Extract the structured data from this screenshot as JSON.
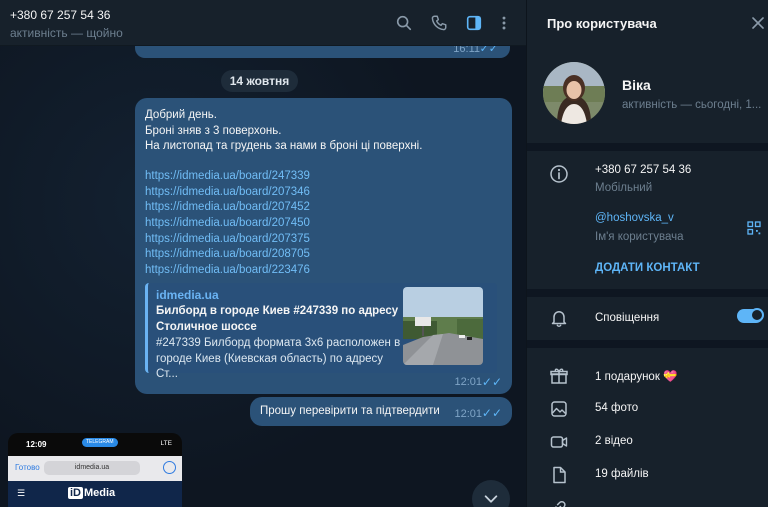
{
  "header": {
    "phone": "+380 67 257 54 36",
    "status": "активність — щойно",
    "icons": [
      "search-icon",
      "phone-icon",
      "sidebar-toggle-icon",
      "more-icon"
    ]
  },
  "chat": {
    "prev_message": {
      "time": "16:11"
    },
    "date_separator": "14 жовтня",
    "message": {
      "lines": [
        "Добрий день.",
        "Броні зняв з 3 поверхонь.",
        "На листопад та грудень за нами в броні ці поверхні."
      ],
      "links": [
        "https://idmedia.ua/board/247339",
        "https://idmedia.ua/board/207346",
        "https://idmedia.ua/board/207452",
        "https://idmedia.ua/board/207450",
        "https://idmedia.ua/board/207375",
        "https://idmedia.ua/board/208705",
        "https://idmedia.ua/board/223476"
      ],
      "preview": {
        "site": "idmedia.ua",
        "title": "Билборд в городе Киев #247339 по адресу Столичное шоссе",
        "description": "#247339 Билборд формата 3x6 расположен в городе Киев (Киевская область) по адресу Ст..."
      },
      "time": "12:01"
    },
    "reply": {
      "text": "Прошу перевірити та підтвердити",
      "time": "12:01"
    },
    "screenshot": {
      "clock": "12:09",
      "badge": "TELEGRAM",
      "network": "LTE",
      "done": "Готово",
      "url": "idmedia.ua",
      "logo_mark": "iD",
      "logo_text": "Media"
    }
  },
  "panel": {
    "title": "Про користувача",
    "name": "Віка",
    "status": "активність — сьогодні, 1...",
    "phone": "+380 67 257 54 36",
    "phone_label": "Мобільний",
    "username": "@hoshovska_v",
    "username_label": "Ім'я користувача",
    "add_contact": "ДОДАТИ КОНТАКТ",
    "notifications": "Сповіщення",
    "notifications_on": true,
    "gifts": "1 подарунок",
    "photos": "54 фото",
    "videos": "2 відео",
    "files": "19 файлів"
  },
  "colors": {
    "accent": "#5eb5f7",
    "bubble": "#2b5278",
    "panel": "#17212b"
  }
}
